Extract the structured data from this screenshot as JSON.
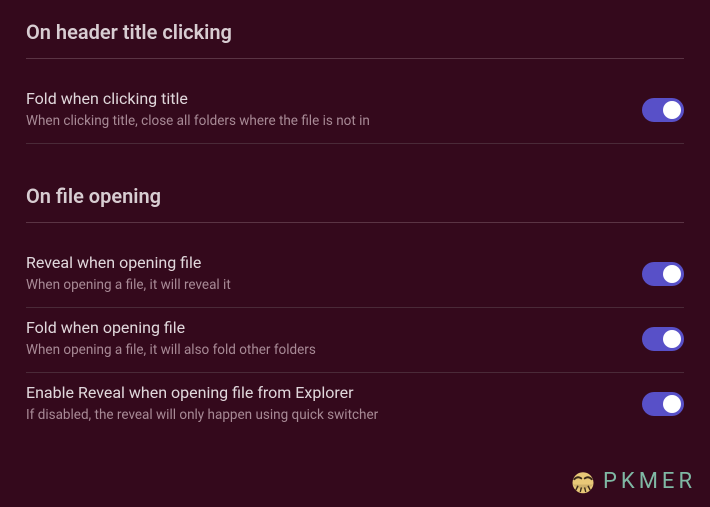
{
  "sections": [
    {
      "header": "On header title clicking",
      "items": [
        {
          "title": "Fold when clicking title",
          "desc": "When clicking title, close all folders where the file is not in",
          "on": true
        }
      ]
    },
    {
      "header": "On file opening",
      "items": [
        {
          "title": "Reveal when opening file",
          "desc": "When opening a file, it will reveal it",
          "on": true
        },
        {
          "title": "Fold when opening file",
          "desc": "When opening a file, it will also fold other folders",
          "on": true
        },
        {
          "title": "Enable Reveal when opening file from Explorer",
          "desc": "If disabled, the reveal will only happen using quick switcher",
          "on": true
        }
      ]
    }
  ],
  "watermark": {
    "text": "PKMER"
  },
  "colors": {
    "toggle_on": "#5850c8",
    "background": "#34091c"
  }
}
